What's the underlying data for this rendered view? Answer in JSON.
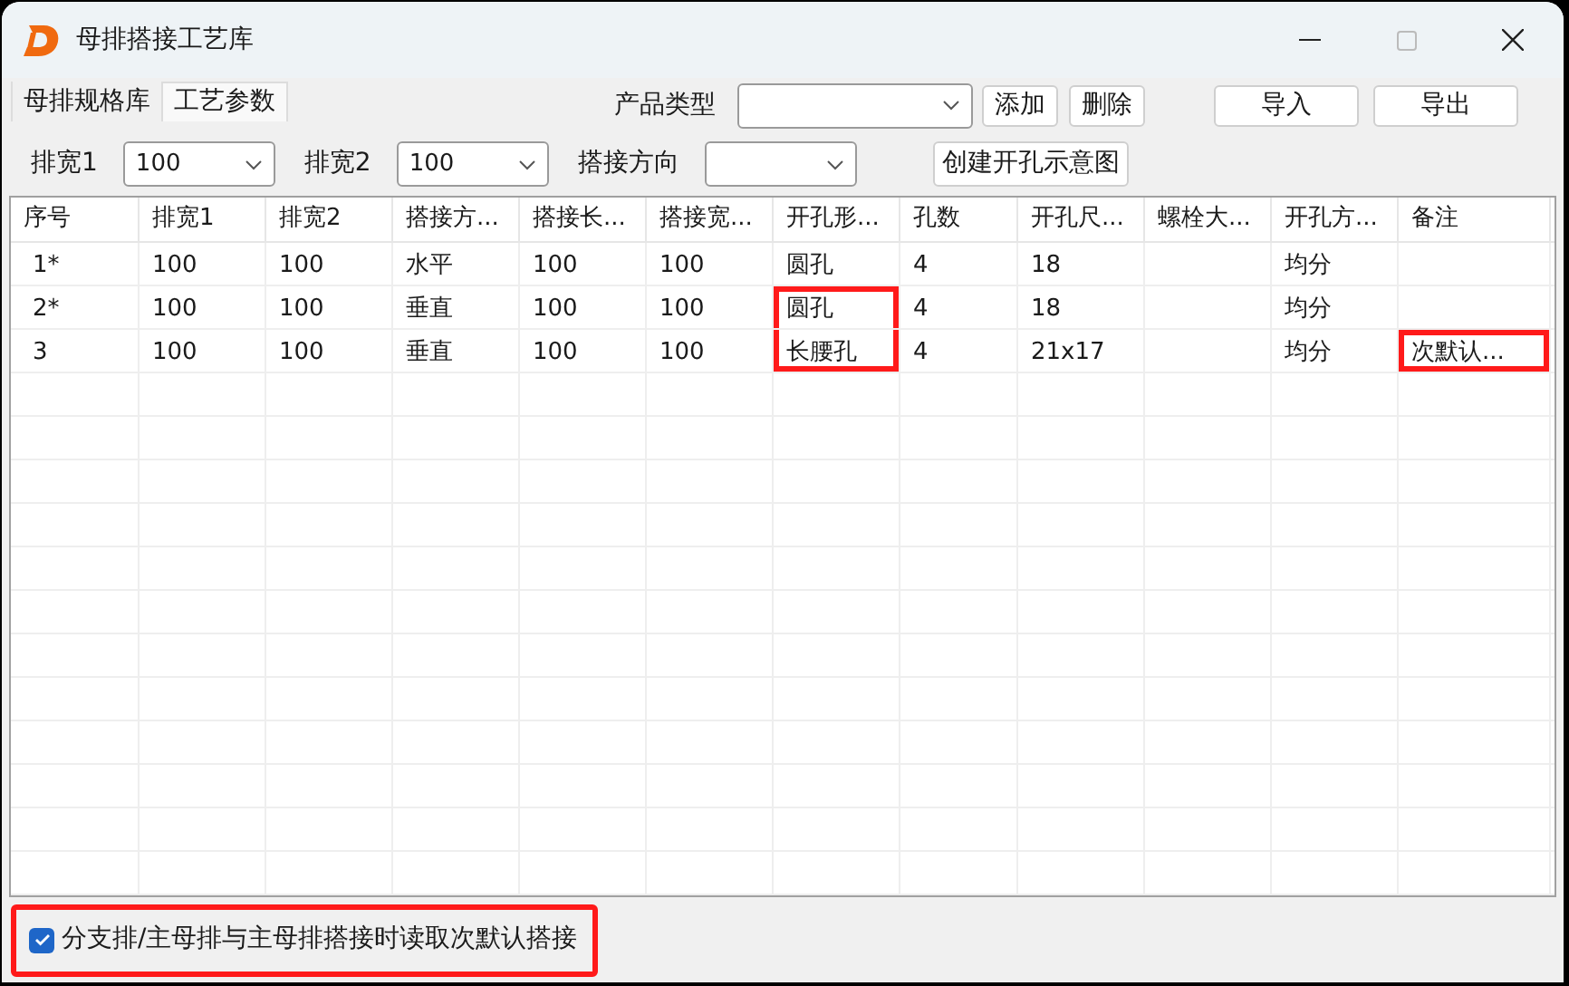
{
  "window": {
    "title": "母排搭接工艺库"
  },
  "tabs": [
    {
      "label": "母排规格库",
      "selected": false
    },
    {
      "label": "工艺参数",
      "selected": true
    }
  ],
  "product_type": {
    "label": "产品类型"
  },
  "buttons_top": [
    "添加",
    "删除"
  ],
  "buttons_right": [
    "导入",
    "导出"
  ],
  "filters": [
    {
      "label": "排宽1",
      "value": "100"
    },
    {
      "label": "排宽2",
      "value": "100"
    },
    {
      "label": "搭接方向"
    }
  ],
  "create_button": "创建开孔示意图",
  "table": {
    "columns": [
      "序号",
      "排宽1",
      "排宽2",
      "搭接方...",
      "搭接长...",
      "搭接宽...",
      "开孔形...",
      "孔数",
      "开孔尺...",
      "螺栓大...",
      "开孔方...",
      "备注"
    ],
    "rows": [
      {
        "cells": [
          {
            "text": "1*",
            "marked": false
          },
          {
            "text": "100",
            "marked": false
          },
          {
            "text": "100",
            "marked": false
          },
          {
            "text": "水平",
            "marked": false
          },
          {
            "text": "100",
            "marked": false
          },
          {
            "text": "100",
            "marked": false
          },
          {
            "text": "圆孔",
            "marked": false
          },
          {
            "text": "4",
            "marked": false
          },
          {
            "text": "18",
            "marked": false
          },
          {
            "marked": false
          },
          {
            "text": "均分",
            "marked": false
          },
          {
            "marked": false
          }
        ]
      },
      {
        "cells": [
          {
            "text": "2*",
            "marked": false
          },
          {
            "text": "100",
            "marked": false
          },
          {
            "text": "100",
            "marked": false
          },
          {
            "text": "垂直",
            "marked": false
          },
          {
            "text": "100",
            "marked": false
          },
          {
            "text": "100",
            "marked": false
          },
          {
            "text": "圆孔",
            "marked": true
          },
          {
            "text": "4",
            "marked": false
          },
          {
            "text": "18",
            "marked": false
          },
          {
            "marked": false
          },
          {
            "text": "均分",
            "marked": false
          },
          {
            "marked": false
          }
        ]
      },
      {
        "cells": [
          {
            "text": "3",
            "marked": false
          },
          {
            "text": "100",
            "marked": false
          },
          {
            "text": "100",
            "marked": false
          },
          {
            "text": "垂直",
            "marked": false
          },
          {
            "text": "100",
            "marked": false
          },
          {
            "text": "100",
            "marked": false
          },
          {
            "text": "长腰孔",
            "marked": true
          },
          {
            "text": "4",
            "marked": false
          },
          {
            "text": "21x17",
            "marked": false
          },
          {
            "marked": false
          },
          {
            "text": "均分",
            "marked": false
          },
          {
            "text": "次默认...",
            "marked": true
          }
        ]
      }
    ]
  },
  "option": {
    "label": "分支排/主母排与主母排搭接时读取次默认搭接",
    "checked": true,
    "marked": true
  }
}
